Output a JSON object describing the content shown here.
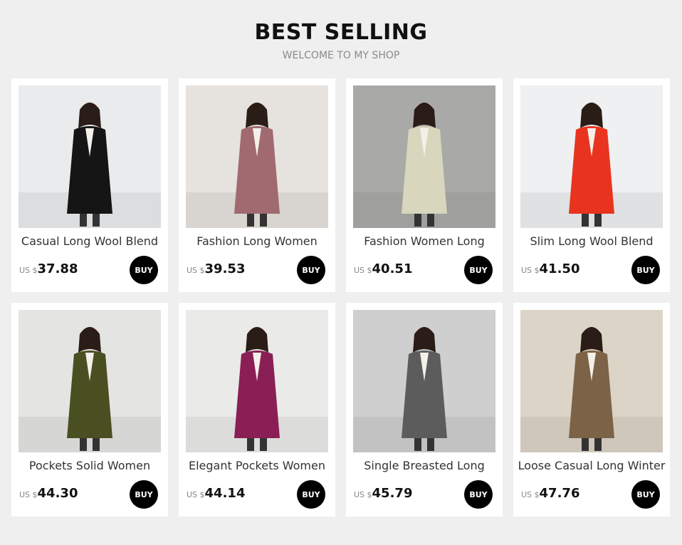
{
  "header": {
    "title": "BEST SELLING",
    "subtitle": "WELCOME TO MY SHOP"
  },
  "products": [
    {
      "name": "Casual Long Wool Blend",
      "currency": "US $",
      "price": "37.88",
      "buy_label": "BUY",
      "coat_color": "#151515",
      "bg_color": "#e9ebec"
    },
    {
      "name": "Fashion Long Women",
      "currency": "US $",
      "price": "39.53",
      "buy_label": "BUY",
      "coat_color": "#a06a70",
      "bg_color": "#e6e2de"
    },
    {
      "name": "Fashion Women Long",
      "currency": "US $",
      "price": "40.51",
      "buy_label": "BUY",
      "coat_color": "#d8d6bd",
      "bg_color": "#a9a9a7"
    },
    {
      "name": "Slim Long Wool Blend",
      "currency": "US $",
      "price": "41.50",
      "buy_label": "BUY",
      "coat_color": "#e8341f",
      "bg_color": "#eef0f2"
    },
    {
      "name": "Pockets Solid Women",
      "currency": "US $",
      "price": "44.30",
      "buy_label": "BUY",
      "coat_color": "#4a4f22",
      "bg_color": "#e4e4e2"
    },
    {
      "name": "Elegant Pockets Women",
      "currency": "US $",
      "price": "44.14",
      "buy_label": "BUY",
      "coat_color": "#8a1f55",
      "bg_color": "#eaeae8"
    },
    {
      "name": "Single Breasted Long",
      "currency": "US $",
      "price": "45.79",
      "buy_label": "BUY",
      "coat_color": "#5c5c5c",
      "bg_color": "#cfcfcf"
    },
    {
      "name": "Loose Casual Long Winter",
      "currency": "US $",
      "price": "47.76",
      "buy_label": "BUY",
      "coat_color": "#7c6247",
      "bg_color": "#dcd4c6"
    }
  ]
}
